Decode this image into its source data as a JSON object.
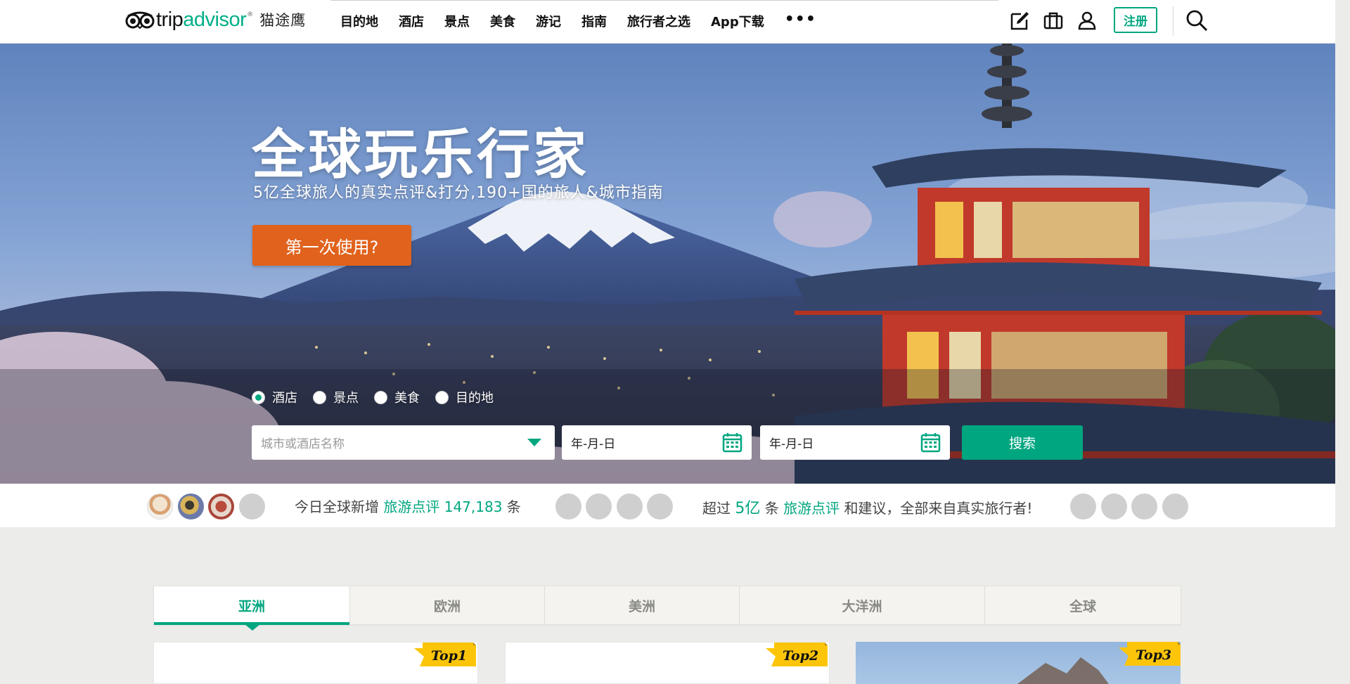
{
  "header": {
    "logo": {
      "trip": "trip",
      "advisor": "advisor",
      "reg": "®",
      "cn": "猫途鹰"
    },
    "nav": [
      "目的地",
      "酒店",
      "景点",
      "美食",
      "游记",
      "指南",
      "旅行者之选",
      "App下载"
    ],
    "more": "•••",
    "icons": [
      "write-review-icon",
      "suitcase-icon",
      "user-icon",
      "search-icon"
    ],
    "signup": "注册"
  },
  "hero": {
    "title": "全球玩乐行家",
    "subtitle": "5亿全球旅人的真实点评&打分,190+国的旅人&城市指南",
    "cta": "第一次使用?",
    "search": {
      "types": [
        {
          "label": "酒店",
          "checked": true
        },
        {
          "label": "景点",
          "checked": false
        },
        {
          "label": "美食",
          "checked": false
        },
        {
          "label": "目的地",
          "checked": false
        }
      ],
      "city_placeholder": "城市或酒店名称",
      "checkin_placeholder": "年-月-日",
      "checkout_placeholder": "年-月-日",
      "button": "搜索"
    }
  },
  "stats": {
    "today_prefix": "今日全球新增",
    "today_link": "旅游点评",
    "today_count": "147,183",
    "today_suffix": "条",
    "total_prefix": "超过",
    "total_count": "5亿",
    "total_mid": "条",
    "total_link": "旅游点评",
    "total_suffix": "和建议，全部来自真实旅行者!"
  },
  "continents": {
    "tabs": [
      "亚洲",
      "欧洲",
      "美洲",
      "大洋洲",
      "全球"
    ],
    "active_index": 0
  },
  "cards": [
    {
      "ribbon": "Top1"
    },
    {
      "ribbon": "Top2"
    },
    {
      "ribbon": "Top3"
    }
  ],
  "colors": {
    "brand_green": "#00a680",
    "cta_orange": "#e0621d",
    "ribbon_yellow": "#fcc50a"
  }
}
